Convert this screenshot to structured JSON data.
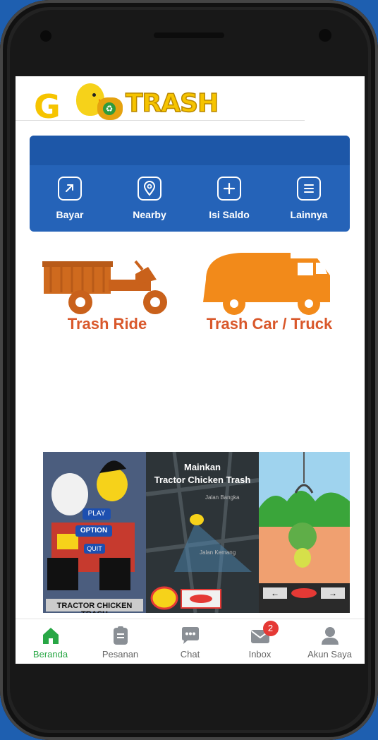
{
  "app": {
    "logo_text": "TRASH",
    "logo_prefix": "G"
  },
  "menu": {
    "items": [
      {
        "label": "Bayar",
        "icon": "upload-icon"
      },
      {
        "label": "Nearby",
        "icon": "map-pin-icon"
      },
      {
        "label": "Isi Saldo",
        "icon": "plus-square-icon"
      },
      {
        "label": "Lainnya",
        "icon": "list-icon"
      }
    ]
  },
  "vehicles": [
    {
      "label": "Trash Ride"
    },
    {
      "label": "Trash Car / Truck"
    }
  ],
  "game_banner": {
    "title_line1": "Mainkan",
    "title_line2": "Tractor Chicken Trash",
    "poster_title": "TRACTOR CHICKEN TRASH",
    "btn_play": "PLAY",
    "btn_option": "OPTION",
    "btn_quit": "QUIT",
    "map_street1": "Jalan Bangka",
    "map_street2": "Jalan Kemang",
    "left_arrow": "←",
    "right_arrow": "→"
  },
  "bottom_nav": {
    "items": [
      {
        "label": "Beranda",
        "icon": "home-icon",
        "active": true
      },
      {
        "label": "Pesanan",
        "icon": "clipboard-icon"
      },
      {
        "label": "Chat",
        "icon": "chat-icon"
      },
      {
        "label": "Inbox",
        "icon": "mail-icon",
        "badge": "2"
      },
      {
        "label": "Akun Saya",
        "icon": "user-icon"
      }
    ]
  },
  "colors": {
    "brand_yellow": "#f6c400",
    "menu_blue": "#2563b8",
    "vehicle_orange": "#d9582b",
    "nav_active": "#28a745",
    "badge_red": "#e53935"
  }
}
